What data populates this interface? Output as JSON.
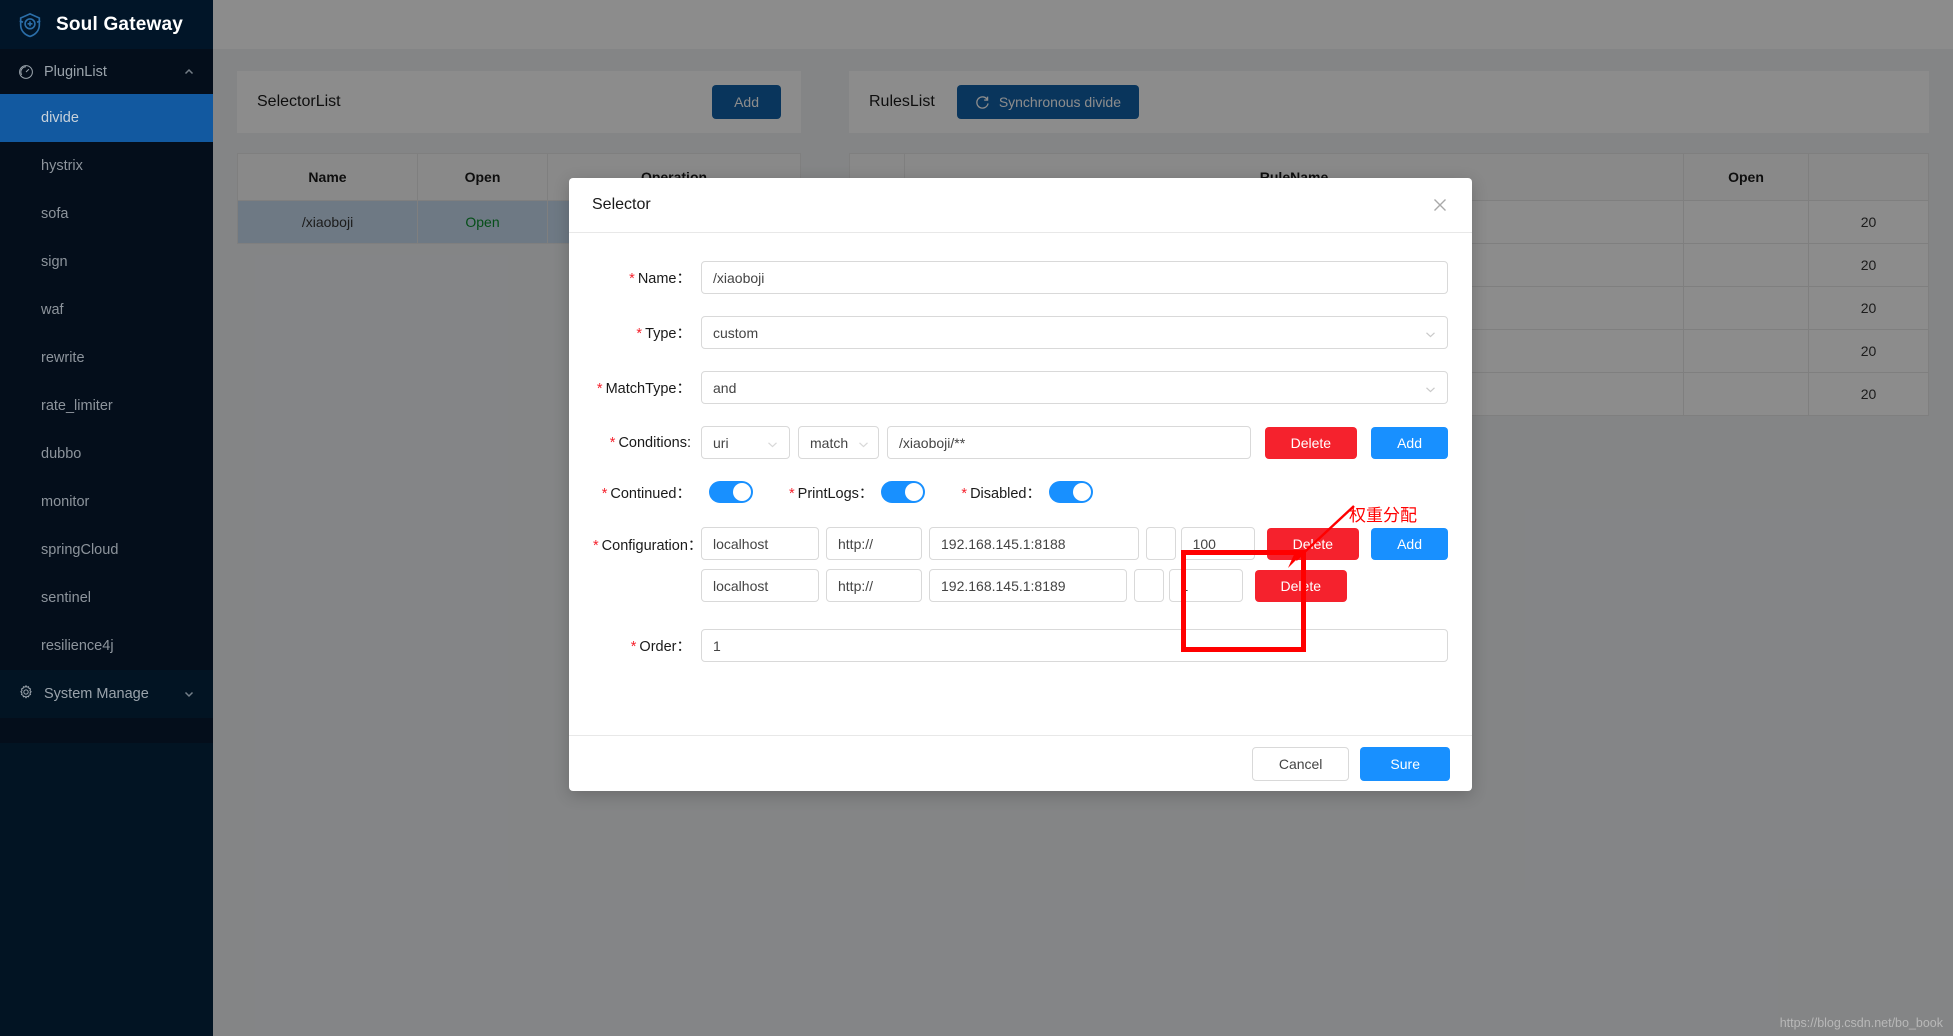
{
  "app": {
    "brand": "Soul Gateway",
    "logo_icon": "shield-plus-icon"
  },
  "sidebar": {
    "group": {
      "label": "PluginList",
      "icon": "dashboard-icon",
      "caret": "chevron-up-icon"
    },
    "items": [
      {
        "label": "divide",
        "active": true
      },
      {
        "label": "hystrix",
        "active": false
      },
      {
        "label": "sofa",
        "active": false
      },
      {
        "label": "sign",
        "active": false
      },
      {
        "label": "waf",
        "active": false
      },
      {
        "label": "rewrite",
        "active": false
      },
      {
        "label": "rate_limiter",
        "active": false
      },
      {
        "label": "dubbo",
        "active": false
      },
      {
        "label": "monitor",
        "active": false
      },
      {
        "label": "springCloud",
        "active": false
      },
      {
        "label": "sentinel",
        "active": false
      },
      {
        "label": "resilience4j",
        "active": false
      }
    ],
    "system_manage": {
      "label": "System Manage",
      "icon": "gear-icon",
      "caret": "chevron-down-icon"
    }
  },
  "selector_panel": {
    "title": "SelectorList",
    "add_label": "Add",
    "columns": [
      "Name",
      "Open",
      "Operation"
    ],
    "rows": [
      {
        "name": "/xiaoboji",
        "open": "Open",
        "operation": ""
      }
    ]
  },
  "rules_panel": {
    "title": "RulesList",
    "sync_label": "Synchronous divide",
    "sync_icon": "refresh-icon",
    "columns": [
      "",
      "RuleName",
      "Open",
      ""
    ],
    "rows": [
      {
        "blank": "",
        "rulename": "",
        "open": "",
        "date": "20"
      },
      {
        "blank": "",
        "rulename": "",
        "open": "",
        "date": "20"
      },
      {
        "blank": "",
        "rulename": "",
        "open": "",
        "date": "20"
      },
      {
        "blank": "",
        "rulename": "",
        "open": "",
        "date": "20"
      },
      {
        "blank": "",
        "rulename": "",
        "open": "",
        "date": "20"
      }
    ]
  },
  "modal": {
    "title": "Selector",
    "close_icon": "close-icon",
    "fields": {
      "name": {
        "label": "Name",
        "value": "/xiaoboji",
        "required": true
      },
      "type": {
        "label": "Type",
        "value": "custom",
        "required": true,
        "caret": "chevron-down-icon"
      },
      "match_type": {
        "label": "MatchType",
        "value": "and",
        "required": true,
        "caret": "chevron-down-icon"
      },
      "conditions": {
        "label": "Conditions",
        "required": true,
        "rows": [
          {
            "param_type": "uri",
            "operator": "match",
            "value": "/xiaoboji/**",
            "delete_label": "Delete",
            "add_label": "Add"
          }
        ]
      },
      "toggles": [
        {
          "label": "Continued",
          "on": true,
          "required": true
        },
        {
          "label": "PrintLogs",
          "on": true,
          "required": true
        },
        {
          "label": "Disabled",
          "on": true,
          "required": true
        }
      ],
      "configuration": {
        "label": "Configuration",
        "required": true,
        "add_label": "Add",
        "rows": [
          {
            "host": "localhost",
            "protocol": "http://",
            "address": "192.168.145.1:8188",
            "weight": "100",
            "delete_label": "Delete"
          },
          {
            "host": "localhost",
            "protocol": "http://",
            "address": "192.168.145.1:8189",
            "weight": "1",
            "delete_label": "Delete"
          }
        ]
      },
      "order": {
        "label": "Order",
        "value": "1",
        "required": true
      }
    },
    "footer": {
      "cancel_label": "Cancel",
      "sure_label": "Sure"
    }
  },
  "annotation": {
    "text": "权重分配",
    "color": "#ff0000"
  },
  "watermark": "https://blog.csdn.net/bo_book",
  "colors": {
    "sidebar_bg": "#040e1b",
    "sidebar_logo_bg": "#011528",
    "sidebar_active": "#1259a0",
    "primary": "#1261a8",
    "accent_blue": "#1890ff",
    "danger": "#f5222d",
    "open_green": "#0a8f2c",
    "annotation_red": "#ff0000"
  }
}
